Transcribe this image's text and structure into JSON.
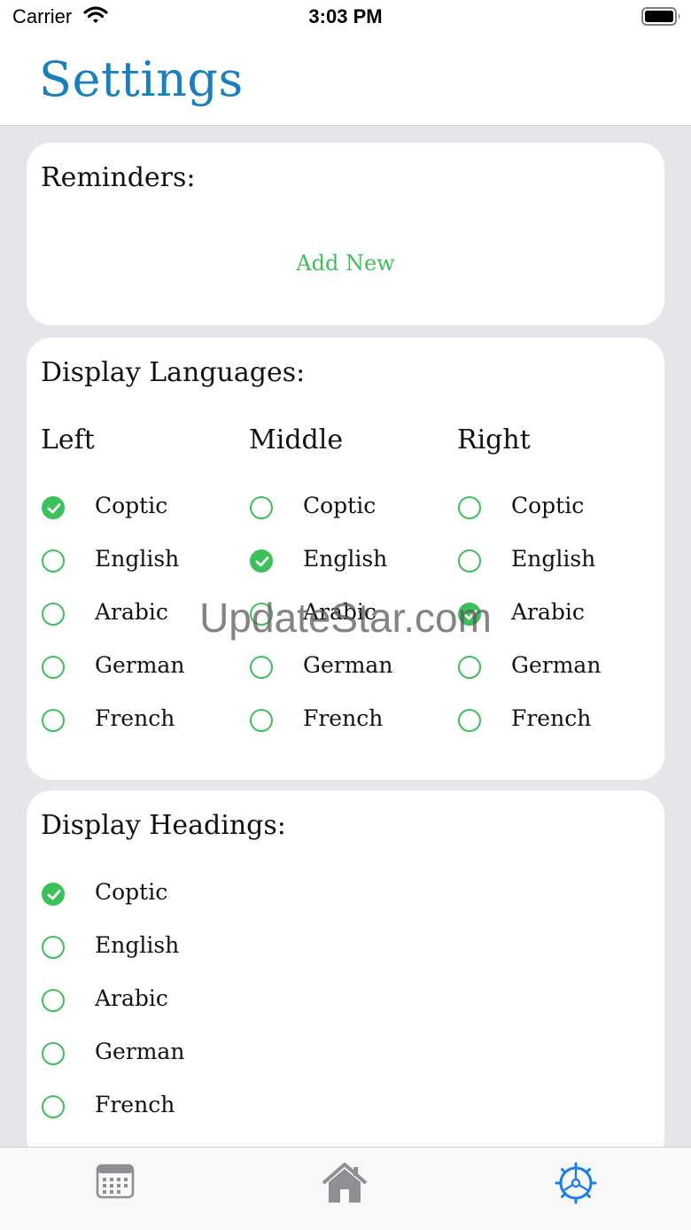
{
  "status_bar": {
    "carrier": "Carrier",
    "time": "3:03 PM"
  },
  "header": {
    "title": "Settings"
  },
  "reminders": {
    "title": "Reminders:",
    "add_new": "Add New"
  },
  "display_languages": {
    "title": "Display Languages:",
    "columns": [
      {
        "header": "Left",
        "options": [
          {
            "label": "Coptic",
            "checked": true
          },
          {
            "label": "English",
            "checked": false
          },
          {
            "label": "Arabic",
            "checked": false
          },
          {
            "label": "German",
            "checked": false
          },
          {
            "label": "French",
            "checked": false
          }
        ]
      },
      {
        "header": "Middle",
        "options": [
          {
            "label": "Coptic",
            "checked": false
          },
          {
            "label": "English",
            "checked": true
          },
          {
            "label": "Arabic",
            "checked": false
          },
          {
            "label": "German",
            "checked": false
          },
          {
            "label": "French",
            "checked": false
          }
        ]
      },
      {
        "header": "Right",
        "options": [
          {
            "label": "Coptic",
            "checked": false
          },
          {
            "label": "English",
            "checked": false
          },
          {
            "label": "Arabic",
            "checked": true
          },
          {
            "label": "German",
            "checked": false
          },
          {
            "label": "French",
            "checked": false
          }
        ]
      }
    ]
  },
  "display_headings": {
    "title": "Display Headings:",
    "options": [
      {
        "label": "Coptic",
        "checked": true
      },
      {
        "label": "English",
        "checked": false
      },
      {
        "label": "Arabic",
        "checked": false
      },
      {
        "label": "German",
        "checked": false
      },
      {
        "label": "French",
        "checked": false
      }
    ]
  },
  "watermark": "UpdateStar.com",
  "tab_bar": {
    "tabs": [
      {
        "icon": "calendar-icon",
        "active": false
      },
      {
        "icon": "home-icon",
        "active": false
      },
      {
        "icon": "settings-wheel-icon",
        "active": true
      }
    ]
  },
  "colors": {
    "accent_green": "#3cc05a",
    "title_blue": "#1a7fbf",
    "active_tab_blue": "#1a7fe8",
    "inactive_tab_gray": "#8e8e93"
  }
}
